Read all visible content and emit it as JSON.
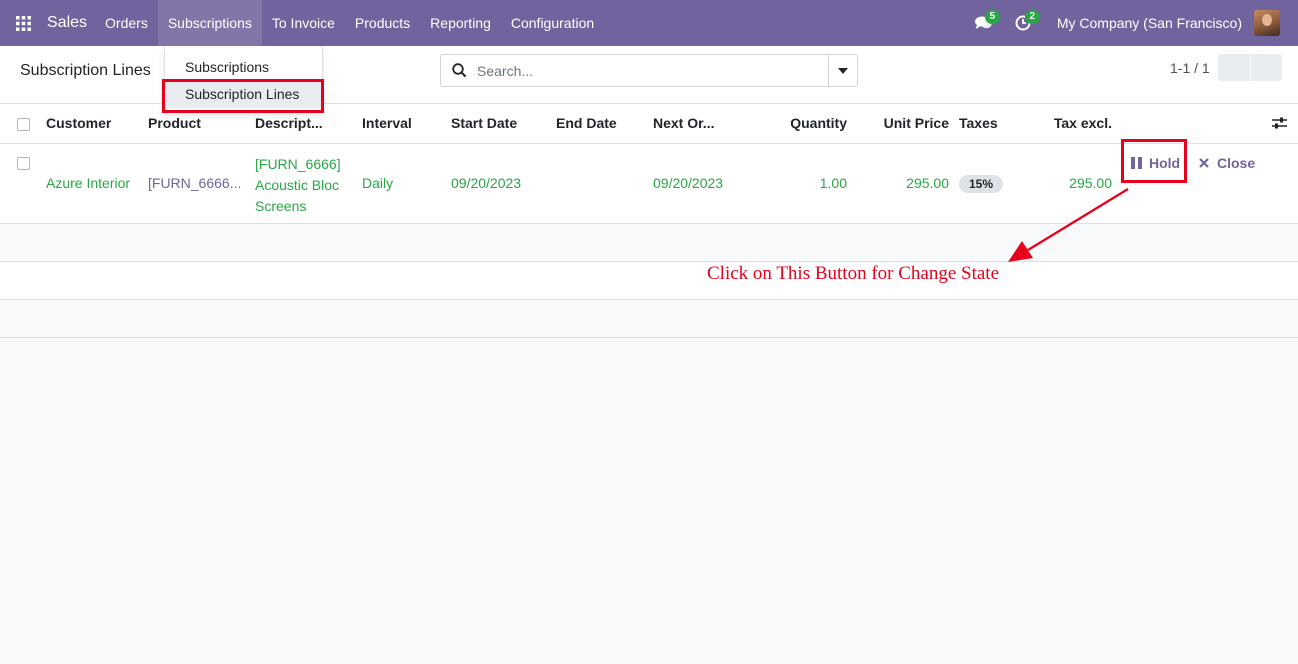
{
  "navbar": {
    "app_name": "Sales",
    "menu": [
      "Orders",
      "Subscriptions",
      "To Invoice",
      "Products",
      "Reporting",
      "Configuration"
    ],
    "messages_count": "5",
    "activities_count": "2",
    "company": "My Company (San Francisco)"
  },
  "control_panel": {
    "title": "Subscription Lines",
    "search_placeholder": "Search...",
    "pager": "1-1 / 1"
  },
  "dropdown": {
    "items": [
      "Subscriptions",
      "Subscription Lines"
    ],
    "selected": "Subscription Lines"
  },
  "table": {
    "columns": [
      "Customer",
      "Product",
      "Descript...",
      "Interval",
      "Start Date",
      "End Date",
      "Next Or...",
      "Quantity",
      "Unit Price",
      "Taxes",
      "Tax excl."
    ],
    "rows": [
      {
        "customer": "Azure Interior",
        "product": "[FURN_6666...",
        "description": [
          "[FURN_6666]",
          "Acoustic Bloc",
          "Screens"
        ],
        "interval": "Daily",
        "start_date": "09/20/2023",
        "end_date": "",
        "next_order": "09/20/2023",
        "quantity": "1.00",
        "unit_price": "295.00",
        "taxes": "15%",
        "tax_excl": "295.00",
        "hold_label": "Hold",
        "close_label": "Close"
      }
    ]
  },
  "annotation": {
    "text": "Click on This Button for Change State",
    "color": "#e8001c"
  },
  "colors": {
    "navbar": "#71639e",
    "accent": "#71639e",
    "value_green": "#28a745",
    "highlight": "#e8001c"
  }
}
